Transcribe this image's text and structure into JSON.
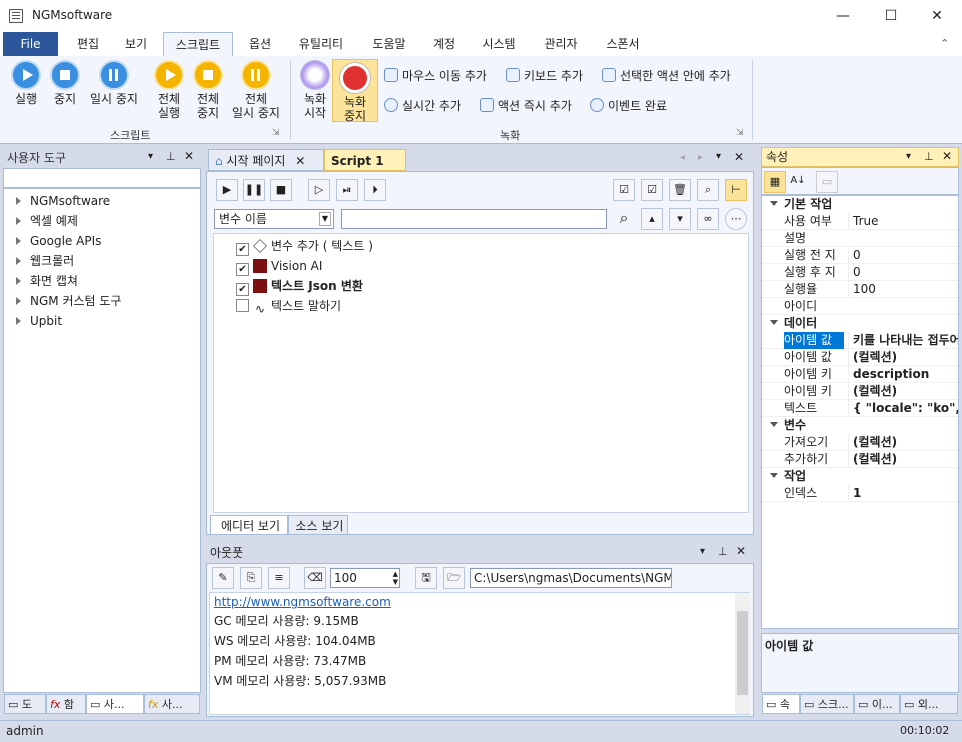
{
  "app": {
    "title": "NGMsoftware"
  },
  "menu": [
    "File",
    "편집",
    "보기",
    "스크립트",
    "옵션",
    "유틸리티",
    "도움말",
    "계정",
    "시스템",
    "관리자",
    "스폰서"
  ],
  "ribbon": {
    "script_group": "스크립트",
    "record_group": "녹화",
    "run": "실행",
    "stop": "중지",
    "pause": "일시 중지",
    "run_all_1": "전체",
    "run_all_2": "실행",
    "stop_all_1": "전체",
    "stop_all_2": "중지",
    "pause_all_1": "전체",
    "pause_all_2": "일시 중지",
    "rec_start_1": "녹화",
    "rec_start_2": "시작",
    "rec_stop_1": "녹화",
    "rec_stop_2": "중지",
    "mouse_move": "마우스 이동 추가",
    "keyboard": "키보드 추가",
    "selected_action": "선택한 액션 안에 추가",
    "realtime": "실시간 추가",
    "action_now": "액션 즉시 추가",
    "event_done": "이벤트 완료"
  },
  "left_panel": {
    "title": "사용자 도구",
    "items": [
      "NGMsoftware",
      "엑셀 예제",
      "Google APIs",
      "웹크롤러",
      "화면 캡쳐",
      "NGM 커스텀 도구",
      "Upbit"
    ],
    "bottom_tabs": [
      "도",
      "함",
      "사...",
      "사..."
    ]
  },
  "editor": {
    "tabs": [
      "시작 페이지",
      "Script 1"
    ],
    "var_select": "변수 이름",
    "search_placeholder": "",
    "nodes": [
      "변수 추가 ( 텍스트 )",
      "Vision AI",
      "텍스트 Json 변환",
      "텍스트 말하기"
    ],
    "bottom_tabs": [
      "에디터 보기",
      "소스 보기"
    ]
  },
  "output": {
    "title": "아웃풋",
    "count": "100",
    "path": "C:\\Users\\ngmas\\Documents\\NGM6\\",
    "link": "http://www.ngmsoftware.com",
    "lines": [
      "GC 메모리 사용량: 9.15MB",
      "WS 메모리 사용량: 104.04MB",
      "PM 메모리 사용량: 73.47MB",
      "VM 메모리 사용량: 5,057.93MB"
    ]
  },
  "props": {
    "title": "속성",
    "cat_basic": "기본 작업",
    "cat_data": "데이터",
    "cat_var": "변수",
    "cat_work": "작업",
    "basic": [
      [
        "사용 여부",
        "True"
      ],
      [
        "설명",
        ""
      ],
      [
        "실행 전 지",
        "0"
      ],
      [
        "실행 후 지",
        "0"
      ],
      [
        "실행율",
        "100"
      ],
      [
        "아이디",
        ""
      ]
    ],
    "data": [
      [
        "아이템 값",
        "키를 나타내는 접두어"
      ],
      [
        "아이템 값",
        "(컬렉션)"
      ],
      [
        "아이템 키",
        "description"
      ],
      [
        "아이템 키",
        "(컬렉션)"
      ],
      [
        "텍스트",
        "{ \"locale\": \"ko\", \""
      ]
    ],
    "var": [
      [
        "가져오기",
        "(컬렉션)"
      ],
      [
        "추가하기",
        "(컬렉션)"
      ]
    ],
    "work": [
      [
        "인덱스",
        "1"
      ]
    ],
    "desc_title": "아이템 값",
    "bottom_tabs": [
      "속",
      "스크...",
      "이...",
      "외..."
    ]
  },
  "status": {
    "user": "admin",
    "time": "00:10:02"
  },
  "colors": {
    "accent": "#2b579a",
    "tab_active": "#fff1b8",
    "frame": "#d6dbe9"
  }
}
